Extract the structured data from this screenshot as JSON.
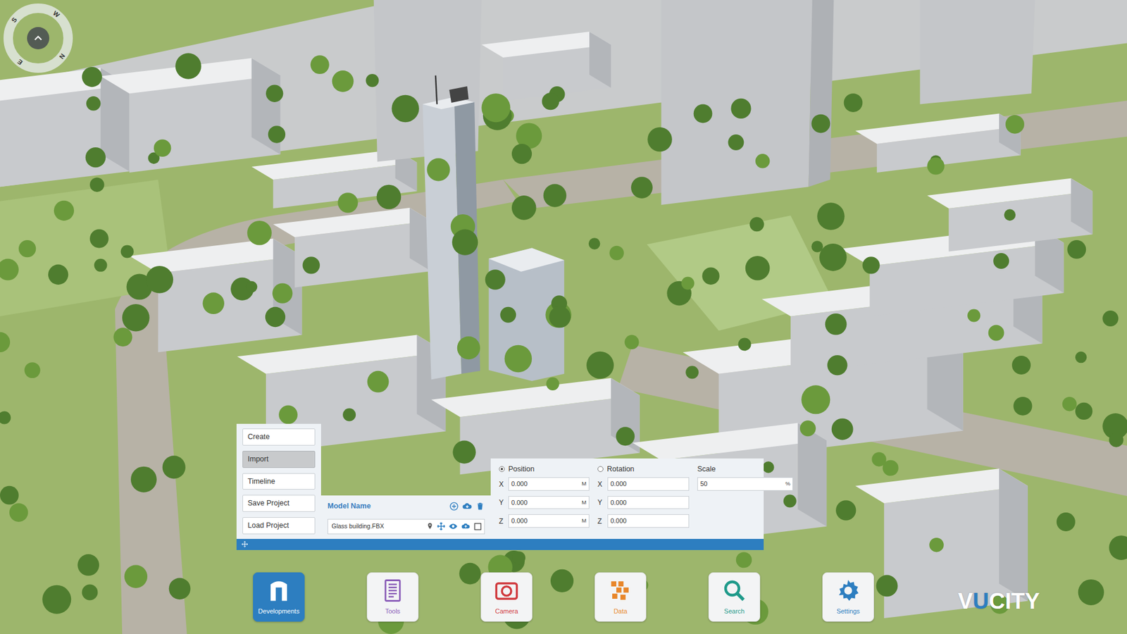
{
  "compass": {
    "marks": [
      "S",
      "W",
      "N",
      "E"
    ]
  },
  "menu": [
    {
      "label": "Create",
      "selected": false
    },
    {
      "label": "Import",
      "selected": true
    },
    {
      "label": "Timeline",
      "selected": false
    },
    {
      "label": "Save Project",
      "selected": false
    },
    {
      "label": "Load Project",
      "selected": false
    }
  ],
  "models": {
    "header": "Model Name",
    "items": [
      {
        "name": "Glass building.FBX"
      }
    ]
  },
  "transform": {
    "modes": [
      {
        "label": "Position",
        "selected": true
      },
      {
        "label": "Rotation",
        "selected": false
      }
    ],
    "position": [
      {
        "axis": "X",
        "value": "0.000",
        "unit": "M"
      },
      {
        "axis": "Y",
        "value": "0.000",
        "unit": "M"
      },
      {
        "axis": "Z",
        "value": "0.000",
        "unit": "M"
      }
    ],
    "rotation": [
      {
        "axis": "X",
        "value": "0.000"
      },
      {
        "axis": "Y",
        "value": "0.000"
      },
      {
        "axis": "Z",
        "value": "0.000"
      }
    ],
    "scale": {
      "label": "Scale",
      "value": "50",
      "unit": "%"
    }
  },
  "toolbar": [
    {
      "label": "Developments",
      "selected": true,
      "color": "#2d7ec0"
    },
    {
      "label": "Tools",
      "selected": false,
      "color": "#8a5cb8"
    },
    {
      "label": "Camera",
      "selected": false,
      "color": "#d0383c"
    },
    {
      "label": "Data",
      "selected": false,
      "color": "#e8862a"
    },
    {
      "label": "Search",
      "selected": false,
      "color": "#1f9a8a"
    },
    {
      "label": "Settings",
      "selected": false,
      "color": "#2d7ec0"
    }
  ],
  "logo": [
    {
      "text": "V",
      "color": "#ffffff"
    },
    {
      "text": "U",
      "color": "#2d7ec0"
    },
    {
      "text": "CITY",
      "color": "#ffffff"
    }
  ]
}
